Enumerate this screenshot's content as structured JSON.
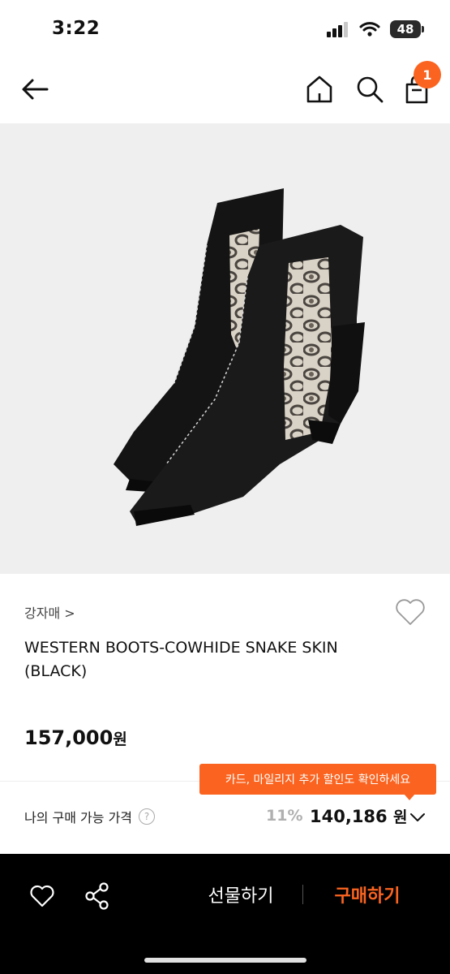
{
  "status_bar": {
    "time": "3:22",
    "battery": "48"
  },
  "nav": {
    "cart_count": "1"
  },
  "product": {
    "brand": "강자매 >",
    "title": "WESTERN BOOTS-COWHIDE SNAKE SKIN (BLACK)",
    "price": "157,000",
    "price_unit": "원"
  },
  "promo": {
    "tooltip": "카드, 마일리지 추가 할인도 확인하세요"
  },
  "my_price": {
    "label": "나의 구매 가능 가격",
    "help": "?",
    "discount_rate": "11%",
    "discount_price": "140,186",
    "unit": "원"
  },
  "bottom_bar": {
    "gift_label": "선물하기",
    "buy_label": "구매하기"
  },
  "colors": {
    "accent": "#fa6420",
    "bottom_bar": "#000000",
    "image_bg": "#efefef"
  }
}
